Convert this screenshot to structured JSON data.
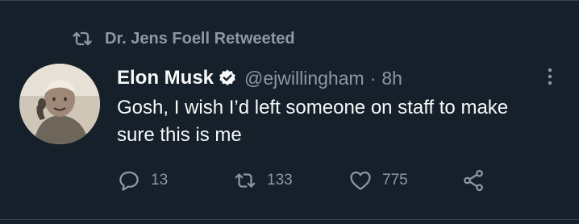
{
  "retweet_banner": {
    "text": "Dr. Jens Foell Retweeted",
    "icon": "retweet-icon"
  },
  "tweet": {
    "author_name": "Elon Musk",
    "verified": true,
    "handle": "@ejwillingham",
    "separator": "·",
    "time": "8h",
    "text": "Gosh, I wish I’d left someone on staff to make sure this is me"
  },
  "actions": {
    "reply_count": "13",
    "retweet_count": "133",
    "like_count": "775"
  },
  "colors": {
    "background": "#15202b",
    "primary_text": "#f7f9f9",
    "secondary_text": "#8b98a5",
    "divider": "#38444d"
  }
}
